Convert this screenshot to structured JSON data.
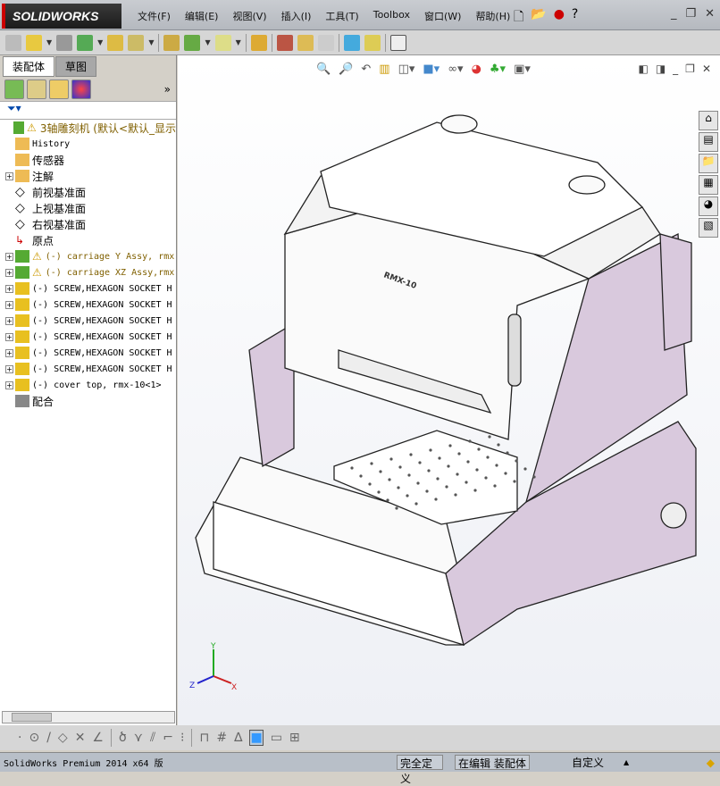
{
  "app": {
    "logo": "SOLIDWORKS"
  },
  "menu": [
    "文件(F)",
    "编辑(E)",
    "视图(V)",
    "插入(I)",
    "工具(T)",
    "Toolbox",
    "窗口(W)",
    "帮助(H)"
  ],
  "tabs": [
    "装配体",
    "草图"
  ],
  "tree": [
    {
      "label": "3轴雕刻机  (默认<默认_显示",
      "icon": "assembly-icon",
      "warn": true,
      "exp": false
    },
    {
      "label": "History",
      "icon": "history-icon",
      "mono": true
    },
    {
      "label": "传感器",
      "icon": "sensor-icon"
    },
    {
      "label": "注解",
      "icon": "annotation-icon",
      "exp": true
    },
    {
      "label": "前视基准面",
      "icon": "plane-icon"
    },
    {
      "label": "上视基准面",
      "icon": "plane-icon"
    },
    {
      "label": "右视基准面",
      "icon": "plane-icon"
    },
    {
      "label": "原点",
      "icon": "origin-icon"
    },
    {
      "label": "(-) carriage Y Assy, rmx",
      "icon": "subassembly-icon",
      "warn": true,
      "exp": true,
      "mono": true
    },
    {
      "label": "(-) carriage XZ Assy,rmx",
      "icon": "subassembly-icon",
      "warn": true,
      "exp": true,
      "mono": true
    },
    {
      "label": "(-) SCREW,HEXAGON SOCKET H",
      "icon": "part-icon",
      "exp": true,
      "mono": true
    },
    {
      "label": "(-) SCREW,HEXAGON SOCKET H",
      "icon": "part-icon",
      "exp": true,
      "mono": true
    },
    {
      "label": "(-) SCREW,HEXAGON SOCKET H",
      "icon": "part-icon",
      "exp": true,
      "mono": true
    },
    {
      "label": "(-) SCREW,HEXAGON SOCKET H",
      "icon": "part-icon",
      "exp": true,
      "mono": true
    },
    {
      "label": "(-) SCREW,HEXAGON SOCKET H",
      "icon": "part-icon",
      "exp": true,
      "mono": true
    },
    {
      "label": "(-) SCREW,HEXAGON SOCKET H",
      "icon": "part-icon",
      "exp": true,
      "mono": true
    },
    {
      "label": "(-) cover top, rmx-10<1>",
      "icon": "part-icon",
      "exp": true,
      "mono": true
    },
    {
      "label": "配合",
      "icon": "mates-icon"
    }
  ],
  "model": {
    "label": "RMX-10"
  },
  "triad": {
    "x": "X",
    "y": "Y",
    "z": "Z"
  },
  "status": {
    "product": "SolidWorks Premium 2014 x64 版",
    "defined": "完全定义",
    "editing": "在编辑 装配体",
    "units": "自定义"
  },
  "colors": {
    "panel": "#d9c9dd",
    "accent": "#0047ab"
  }
}
